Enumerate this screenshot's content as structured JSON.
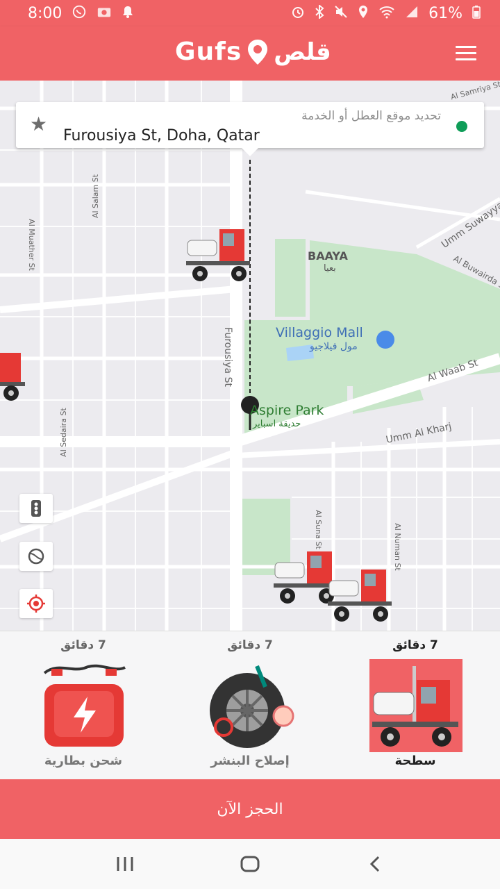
{
  "status_bar": {
    "time": "8:00",
    "battery": "61%",
    "left_icons": [
      "whatsapp-icon",
      "camera-icon",
      "notification-bell-icon"
    ],
    "right_icons": [
      "alarm-icon",
      "bluetooth-icon",
      "mute-icon",
      "location-icon",
      "wifi-icon",
      "signal-icon",
      "battery-icon"
    ]
  },
  "header": {
    "logo_latin": "Gufs",
    "logo_arabic": "قلص",
    "menu_icon": "hamburger-menu-icon"
  },
  "search": {
    "hint": "تحديد موقع العطل أو الخدمة",
    "value": "Furousiya St, Doha, Qatar",
    "favorite_icon": "star-icon",
    "status_color": "#0F9D58"
  },
  "map": {
    "labels": {
      "baaya_en": "BAAYA",
      "baaya_ar": "بعيا",
      "villaggio_en": "Villaggio Mall",
      "villaggio_ar": "مول فيلاجيو",
      "aspire_en": "Aspire Park",
      "aspire_ar": "حديقة اسباير",
      "furousiya": "Furousiya St",
      "al_waab": "Al Waab St",
      "umm_al_kharj": "Umm Al Kharj",
      "al_buwairda": "Al Buwairda St",
      "umm_suwayya": "Umm Suwayya",
      "al_samriya": "Al Samriya St",
      "al_salam": "Al Salam St",
      "al_muather": "Al Muather St",
      "al_sedaira": "Al Sedaira St",
      "al_suna": "Al Suna St",
      "al_numan": "Al Numan St"
    },
    "controls": [
      "traffic-light-icon",
      "globe-layers-icon",
      "my-location-icon"
    ]
  },
  "services": [
    {
      "eta": "7 دقائق",
      "name": "سطحة",
      "icon": "flatbed-tow-truck-icon",
      "selected": true
    },
    {
      "eta": "7 دقائق",
      "name": "إصلاح البنشر",
      "icon": "tire-repair-icon",
      "selected": false
    },
    {
      "eta": "7 دقائق",
      "name": "شحن بطارية",
      "icon": "battery-jump-start-icon",
      "selected": false
    }
  ],
  "book_button": "الحجز الآن",
  "nav": [
    "recent-apps-icon",
    "home-icon",
    "back-icon"
  ],
  "colors": {
    "brand": "#F06265",
    "park_green": "#C8E6C9",
    "water": "#AAD3F6"
  }
}
